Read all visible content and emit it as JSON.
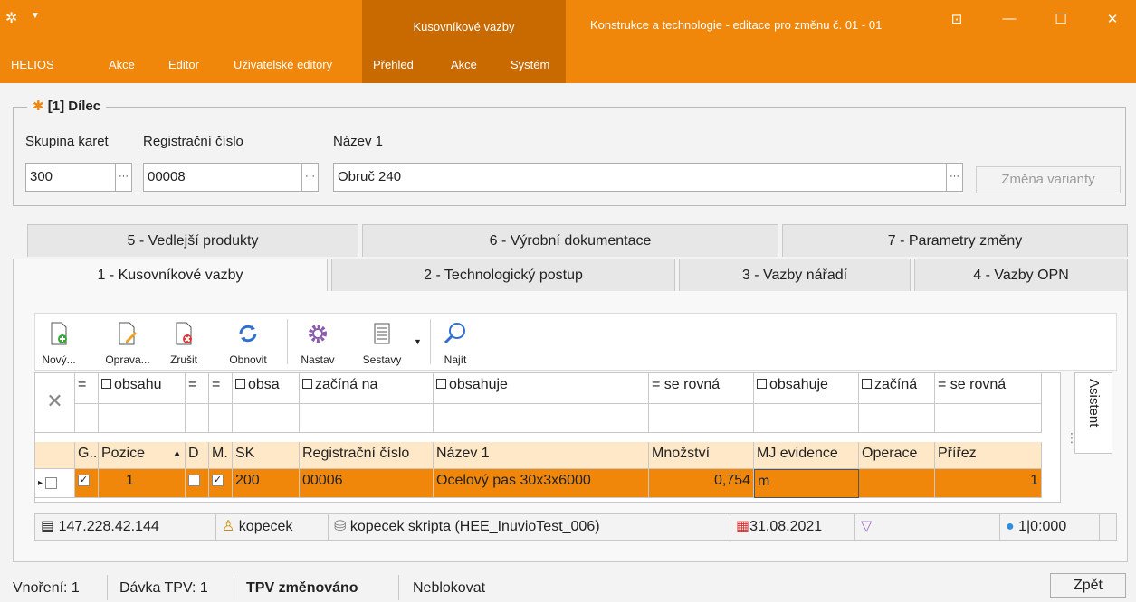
{
  "titlebar": {
    "context_tab": "Kusovníkové vazby",
    "window_title": "Konstrukce a technologie - editace pro změnu č. 01 - 01",
    "menu_main": [
      "HELIOS",
      "Akce",
      "Editor",
      "Uživatelské editory"
    ],
    "menu_ctx": [
      "Přehled",
      "Akce",
      "Systém"
    ],
    "colors": {
      "accent": "#f0870a",
      "context": "#c96a00"
    }
  },
  "dilec": {
    "title": "[1] Dílec",
    "label_skupina": "Skupina karet",
    "label_reg": "Registrační číslo",
    "label_nazev": "Název 1",
    "skupina": "300",
    "reg": "00008",
    "nazev": "Obruč 240",
    "zmena_button": "Změna varianty"
  },
  "tabs_row1": [
    "5 - Vedlejší produkty",
    "6 - Výrobní dokumentace",
    "7 - Parametry změny"
  ],
  "tabs_row2": [
    "1 - Kusovníkové vazby",
    "2 - Technologický postup",
    "3 - Vazby nářadí",
    "4 - Vazby OPN"
  ],
  "toolbar": [
    "Nový...",
    "Oprava...",
    "Zrušit",
    "Obnovit",
    "Nastav",
    "Sestavy",
    "Najít"
  ],
  "filter_row": [
    "=",
    "obsahu",
    "=",
    "=",
    "obsa",
    "začíná na",
    "obsahuje",
    "= se rovná",
    "obsahuje",
    "začíná",
    "= se rovná"
  ],
  "columns": [
    "G..",
    "Pozice",
    "D",
    "M.",
    "SK",
    "Registrační číslo",
    "Název 1",
    "Množství",
    "MJ evidence",
    "Operace",
    "Přířez"
  ],
  "row": {
    "g_checked": "✓",
    "pozice": "1",
    "m_checked": "✓",
    "sk": "200",
    "reg": "00006",
    "nazev": "Ocelový pas 30x3x6000",
    "mnozstvi": "0,754",
    "mj": "m",
    "operace": "",
    "prirez": "1"
  },
  "sort_indicator": "▲",
  "asistent": "Asistent",
  "status": {
    "ip": "147.228.42.144",
    "user": "kopecek",
    "db": "kopecek skripta (HEE_InuvioTest_006)",
    "date": "31.08.2021",
    "info": "1|0:000"
  },
  "bottom": {
    "vnoreni": "Vnoření: 1",
    "davka": "Dávka TPV: 1",
    "tpv": "TPV změnováno",
    "neblokovat": "Neblokovat",
    "zpet": "Zpět"
  }
}
